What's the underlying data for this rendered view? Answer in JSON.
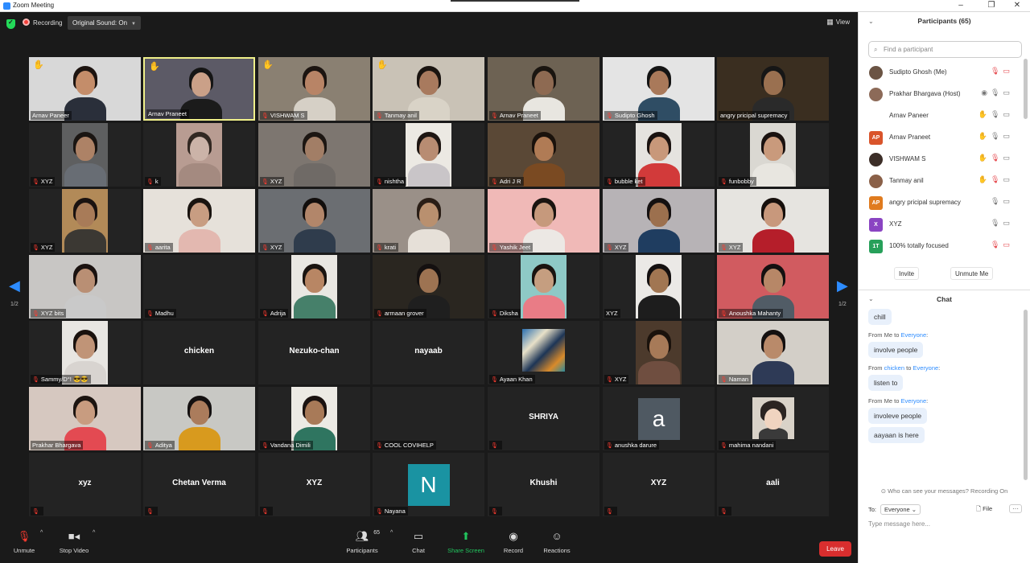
{
  "window": {
    "title": "Zoom Meeting"
  },
  "topbar": {
    "recording_label": "Recording",
    "original_sound": "Original Sound: On",
    "view_label": "View"
  },
  "page_nav": {
    "left": "1/2",
    "right": "1/2"
  },
  "tiles": [
    {
      "name": "Arnav Paneer",
      "muted": false,
      "hand": true,
      "type": "video",
      "bg": "#d8d8d8",
      "skin": "#c48d6a",
      "shirt": "#2a2f3a",
      "hair": "#1d1410"
    },
    {
      "name": "Arnav Praneet",
      "muted": false,
      "hand": true,
      "type": "video",
      "highlight": true,
      "bg": "#5c5a66",
      "skin": "#caa088",
      "shirt": "#1b1b1b",
      "hair": "#151515"
    },
    {
      "name": "VISHWAM S",
      "muted": true,
      "hand": true,
      "type": "video",
      "bg": "#8a8072",
      "skin": "#b88466",
      "shirt": "#d6d0c6",
      "hair": "#1c1410"
    },
    {
      "name": "Tanmay anil",
      "muted": true,
      "hand": true,
      "type": "video",
      "bg": "#c9c2b6",
      "skin": "#a87a5e",
      "shirt": "#d9d3c7",
      "hair": "#1a1410"
    },
    {
      "name": "Arnav Praneet",
      "muted": true,
      "hand": false,
      "type": "video",
      "bg": "#6d6253",
      "skin": "#8e6a52",
      "shirt": "#e8e6e0",
      "hair": "#1a1510"
    },
    {
      "name": "Sudipto Ghosh",
      "muted": true,
      "hand": false,
      "type": "video",
      "bg": "#e4e4e4",
      "skin": "#a9795a",
      "shirt": "#2f4d64",
      "hair": "#141414"
    },
    {
      "name": "angry pricipal supremacy",
      "muted": false,
      "hand": false,
      "type": "video",
      "bg": "#3a2e20",
      "skin": "#9a7050",
      "shirt": "#2a2a2a",
      "hair": "#161616"
    },
    {
      "name": "XYZ",
      "muted": true,
      "hand": false,
      "type": "video",
      "narrow": true,
      "bg": "#5e5f60",
      "skin": "#ad8266",
      "shirt": "#686d74",
      "hair": "#1a1512"
    },
    {
      "name": "k",
      "muted": true,
      "hand": false,
      "type": "video",
      "narrow": true,
      "bg": "#b89c92",
      "skin": "#cbb3a8",
      "shirt": "#a48a80",
      "hair": "#322822"
    },
    {
      "name": "XYZ",
      "muted": true,
      "hand": false,
      "type": "video",
      "bg": "#7d7670",
      "skin": "#a27e66",
      "shirt": "#6f6a66",
      "hair": "#1c1612"
    },
    {
      "name": "nishtha",
      "muted": true,
      "hand": false,
      "type": "video",
      "narrow": true,
      "bg": "#ece9e3",
      "skin": "#b88c72",
      "shirt": "#c9c5c8",
      "hair": "#1e1612"
    },
    {
      "name": "Adri J R",
      "muted": true,
      "hand": false,
      "type": "video",
      "bg": "#5a4836",
      "skin": "#b07b55",
      "shirt": "#7a4a22",
      "hair": "#1a120c"
    },
    {
      "name": "bubble ket",
      "muted": true,
      "hand": false,
      "type": "video",
      "narrow": true,
      "bg": "#e5e3df",
      "skin": "#c8987a",
      "shirt": "#d23a3a",
      "hair": "#1a1210"
    },
    {
      "name": "funbobby",
      "muted": true,
      "hand": false,
      "type": "video",
      "narrow": true,
      "bg": "#dad8d2",
      "skin": "#c99a7c",
      "shirt": "#e8e6e0",
      "hair": "#1a1210"
    },
    {
      "name": "XYZ",
      "muted": true,
      "hand": false,
      "type": "video",
      "narrow": true,
      "bg": "#b28a58",
      "skin": "#a87b58",
      "shirt": "#3b3833",
      "hair": "#1a1210"
    },
    {
      "name": "aarita",
      "muted": true,
      "hand": false,
      "type": "video",
      "bg": "#e6e1da",
      "skin": "#c89d82",
      "shirt": "#e3b8b0",
      "hair": "#1a1410"
    },
    {
      "name": "XYZ",
      "muted": true,
      "hand": false,
      "type": "video",
      "bg": "#6b6e72",
      "skin": "#b2866a",
      "shirt": "#2f3c4c",
      "hair": "#120e0c"
    },
    {
      "name": "krati",
      "muted": true,
      "hand": false,
      "type": "video",
      "bg": "#9a9088",
      "skin": "#b9906f",
      "shirt": "#e6e0d8",
      "hair": "#2a1e16"
    },
    {
      "name": "Yashik Jeet",
      "muted": true,
      "hand": false,
      "type": "video",
      "bg": "#f0b9b7",
      "skin": "#c6997c",
      "shirt": "#ece8e4",
      "hair": "#1a1410"
    },
    {
      "name": "XYZ",
      "muted": true,
      "hand": false,
      "type": "video",
      "bg": "#b7b3b6",
      "skin": "#9c704e",
      "shirt": "#1f3d60",
      "hair": "#141010"
    },
    {
      "name": "XYZ",
      "muted": true,
      "hand": false,
      "type": "video",
      "bg": "#e6e4e0",
      "skin": "#c8987c",
      "shirt": "#b51e2a",
      "hair": "#160f0c"
    },
    {
      "name": "XYZ bits",
      "muted": true,
      "hand": false,
      "type": "video",
      "bg": "#c8c6c4",
      "skin": "#b98f74",
      "shirt": "#c9c9c9",
      "hair": "#1a1210"
    },
    {
      "name": "Madhu",
      "muted": true,
      "hand": false,
      "type": "blank"
    },
    {
      "name": "Adrija",
      "muted": true,
      "hand": false,
      "type": "video",
      "narrow": true,
      "bg": "#e9e7e2",
      "skin": "#b88664",
      "shirt": "#46806a",
      "hair": "#1a1410"
    },
    {
      "name": "armaan grover",
      "muted": true,
      "hand": false,
      "type": "video",
      "bg": "#2a2620",
      "skin": "#9d7352",
      "shirt": "#1f1f1f",
      "hair": "#141010"
    },
    {
      "name": "Diksha",
      "muted": true,
      "hand": false,
      "type": "video",
      "narrow": true,
      "bg": "#8ec9c6",
      "skin": "#c59e80",
      "shirt": "#e97c86",
      "hair": "#1a1410"
    },
    {
      "name": "XYZ",
      "muted": false,
      "hand": false,
      "type": "video",
      "narrow": true,
      "bg": "#ebe9e6",
      "skin": "#a17652",
      "shirt": "#1d1d1d",
      "hair": "#141010"
    },
    {
      "name": "Anoushka Mahanty",
      "muted": true,
      "hand": false,
      "type": "video",
      "bg": "#d15b60",
      "skin": "#b78767",
      "shirt": "#515c66",
      "hair": "#141010"
    },
    {
      "name": "Sammy/D°! 😎😎",
      "muted": true,
      "hand": false,
      "type": "video",
      "narrow": true,
      "bg": "#e8e6e2",
      "skin": "#c09477",
      "shirt": "#d8d4d0",
      "hair": "#1a120e"
    },
    {
      "name": "",
      "label": "chicken",
      "muted": false,
      "hand": false,
      "type": "label"
    },
    {
      "name": "",
      "label": "Nezuko-chan",
      "muted": false,
      "hand": false,
      "type": "label"
    },
    {
      "name": "",
      "label": "nayaab",
      "muted": false,
      "hand": false,
      "type": "label"
    },
    {
      "name": "Ayaan Khan",
      "muted": true,
      "hand": false,
      "type": "art"
    },
    {
      "name": "XYZ",
      "muted": true,
      "hand": false,
      "type": "video",
      "narrow": true,
      "bg": "#4c3a2c",
      "skin": "#a77a58",
      "shirt": "#6f4e40",
      "hair": "#1a120c"
    },
    {
      "name": "Naman",
      "muted": true,
      "hand": false,
      "type": "video",
      "bg": "#d3cfc8",
      "skin": "#b98a6a",
      "shirt": "#2e3a56",
      "hair": "#141010"
    },
    {
      "name": "Prakhar Bhargava",
      "muted": false,
      "hand": false,
      "type": "video",
      "bg": "#d6c8c0",
      "skin": "#c89c80",
      "shirt": "#e34a52",
      "hair": "#1c1410"
    },
    {
      "name": "Aditya",
      "muted": true,
      "hand": false,
      "type": "video",
      "bg": "#c8c8c4",
      "skin": "#ab7c5c",
      "shirt": "#d89a1e",
      "hair": "#141010"
    },
    {
      "name": "Vandana Dimili",
      "muted": true,
      "hand": false,
      "type": "video",
      "narrow": true,
      "bg": "#eceae4",
      "skin": "#a87a58",
      "shirt": "#2f7560",
      "hair": "#1a1210"
    },
    {
      "name": "COOL COVIHELP",
      "muted": true,
      "hand": false,
      "type": "blank"
    },
    {
      "name": "",
      "label": "SHRIYA",
      "muted": true,
      "hand": false,
      "type": "label"
    },
    {
      "name": "anushka darure",
      "muted": true,
      "hand": false,
      "type": "avatar",
      "letter": "a",
      "color": "#4f5962"
    },
    {
      "name": "mahima nandani",
      "muted": true,
      "hand": false,
      "type": "cartoon"
    },
    {
      "name": "",
      "label": "xyz",
      "muted": true,
      "hand": false,
      "type": "label"
    },
    {
      "name": "",
      "label": "Chetan Verma",
      "muted": true,
      "hand": false,
      "type": "label"
    },
    {
      "name": "",
      "label": "XYZ",
      "muted": true,
      "hand": false,
      "type": "label"
    },
    {
      "name": "Nayana",
      "muted": true,
      "hand": false,
      "type": "avatar",
      "letter": "N",
      "color": "#1a93a2"
    },
    {
      "name": "",
      "label": "Khushi",
      "muted": true,
      "hand": false,
      "type": "label"
    },
    {
      "name": "",
      "label": "XYZ",
      "muted": true,
      "hand": false,
      "type": "label"
    },
    {
      "name": "",
      "label": "aali",
      "muted": true,
      "hand": false,
      "type": "label"
    }
  ],
  "toolbar": {
    "unmute": "Unmute",
    "stop_video": "Stop Video",
    "participants": "Participants",
    "participants_count": "65",
    "chat": "Chat",
    "share_screen": "Share Screen",
    "record": "Record",
    "reactions": "Reactions",
    "leave": "Leave"
  },
  "participants_panel": {
    "title": "Participants (65)",
    "search_placeholder": "Find a participant",
    "items": [
      {
        "name": "Sudipto Ghosh (Me)",
        "avatar_type": "photo",
        "avatar_color": "#6b5444",
        "initials": "",
        "icons": [
          "muted",
          "cam-off"
        ]
      },
      {
        "name": "Prakhar Bhargava (Host)",
        "avatar_type": "photo",
        "avatar_color": "#8c6a58",
        "initials": "",
        "icons": [
          "rec",
          "mic",
          "cam"
        ]
      },
      {
        "name": "Arnav Paneer",
        "avatar_type": "none",
        "avatar_color": "#ffffff",
        "initials": "",
        "icons": [
          "hand",
          "mic",
          "cam"
        ]
      },
      {
        "name": "Arnav Praneet",
        "avatar_type": "initials",
        "avatar_color": "#d9542b",
        "initials": "AP",
        "icons": [
          "hand",
          "mic",
          "cam"
        ]
      },
      {
        "name": "VISHWAM S",
        "avatar_type": "photo",
        "avatar_color": "#3c2e28",
        "initials": "",
        "icons": [
          "hand",
          "muted",
          "cam"
        ]
      },
      {
        "name": "Tanmay anil",
        "avatar_type": "photo",
        "avatar_color": "#8a6048",
        "initials": "",
        "icons": [
          "hand",
          "muted",
          "cam"
        ]
      },
      {
        "name": "angry pricipal supremacy",
        "avatar_type": "initials",
        "avatar_color": "#e07b1f",
        "initials": "AP",
        "icons": [
          "mic",
          "cam"
        ]
      },
      {
        "name": "XYZ",
        "avatar_type": "initials",
        "avatar_color": "#8a44c2",
        "initials": "X",
        "icons": [
          "mic",
          "cam"
        ]
      },
      {
        "name": "100% totally focused",
        "avatar_type": "initials",
        "avatar_color": "#27a05a",
        "initials": "1T",
        "icons": [
          "muted",
          "cam-off"
        ]
      }
    ],
    "invite": "Invite",
    "unmute_me": "Unmute Me"
  },
  "chat": {
    "title": "Chat",
    "messages": [
      {
        "from": "",
        "to": "",
        "text": "chill"
      },
      {
        "from": "Me",
        "to": "Everyone",
        "text": "involve people"
      },
      {
        "from": "chicken",
        "to": "Everyone",
        "text": "listen to"
      },
      {
        "from": "Me",
        "to": "Everyone",
        "text": "involeve people"
      },
      {
        "from": "",
        "to": "",
        "text": "aayaan is here"
      }
    ],
    "from_prefix": "From",
    "to_word": "to",
    "who_can_see": "Who can see your messages? Recording On",
    "to_label": "To:",
    "to_value": "Everyone",
    "file_label": "File",
    "more_label": "···",
    "placeholder": "Type message here..."
  },
  "colors": {
    "accent": "#2d8cff",
    "muted_icon": "#ff3b30",
    "share_green": "#22c55e",
    "leave_red": "#d92e2e",
    "hand_yellow": "#f4c542",
    "highlight_border": "#f0f08a"
  }
}
